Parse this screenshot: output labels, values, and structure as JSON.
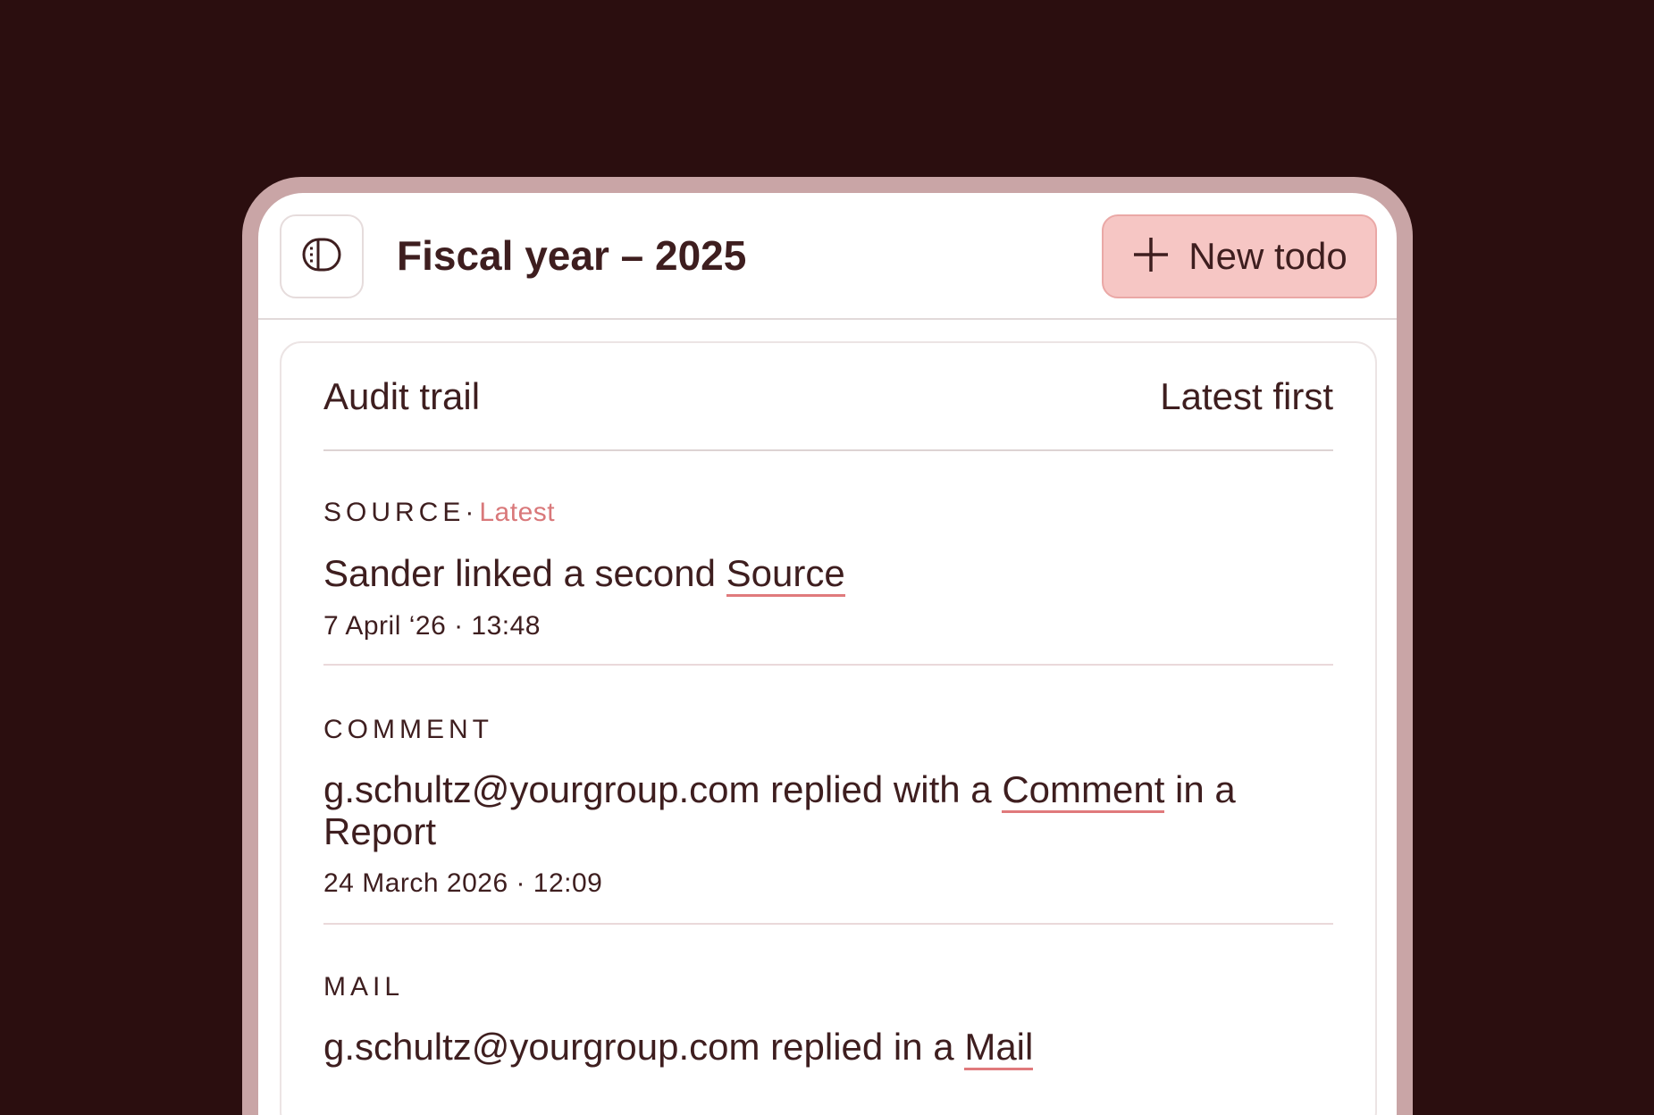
{
  "header": {
    "title": "Fiscal year – 2025",
    "new_todo_label": "New todo"
  },
  "audit": {
    "title": "Audit trail",
    "sort_label": "Latest first",
    "entries": [
      {
        "type": "SOURCE",
        "tag": "Latest",
        "text_before": "Sander linked a second ",
        "link": "Source",
        "text_after": "",
        "time": "7 April ‘26 · 13:48"
      },
      {
        "type": "COMMENT",
        "tag": "",
        "text_before": "g.schultz@yourgroup.com replied with a ",
        "link": "Comment",
        "text_after": " in a Report",
        "time": "24 March 2026 · 12:09"
      },
      {
        "type": "MAIL",
        "tag": "",
        "text_before": "g.schultz@yourgroup.com replied in a ",
        "link": "Mail",
        "text_after": "",
        "time": ""
      }
    ]
  },
  "colors": {
    "background": "#2b0e0f",
    "accent": "#f6c6c4",
    "link_underline": "#e07a7c",
    "text": "#3e1e1f"
  },
  "icons": {
    "sidebar": "sidebar-toggle-icon",
    "add": "plus-icon"
  }
}
